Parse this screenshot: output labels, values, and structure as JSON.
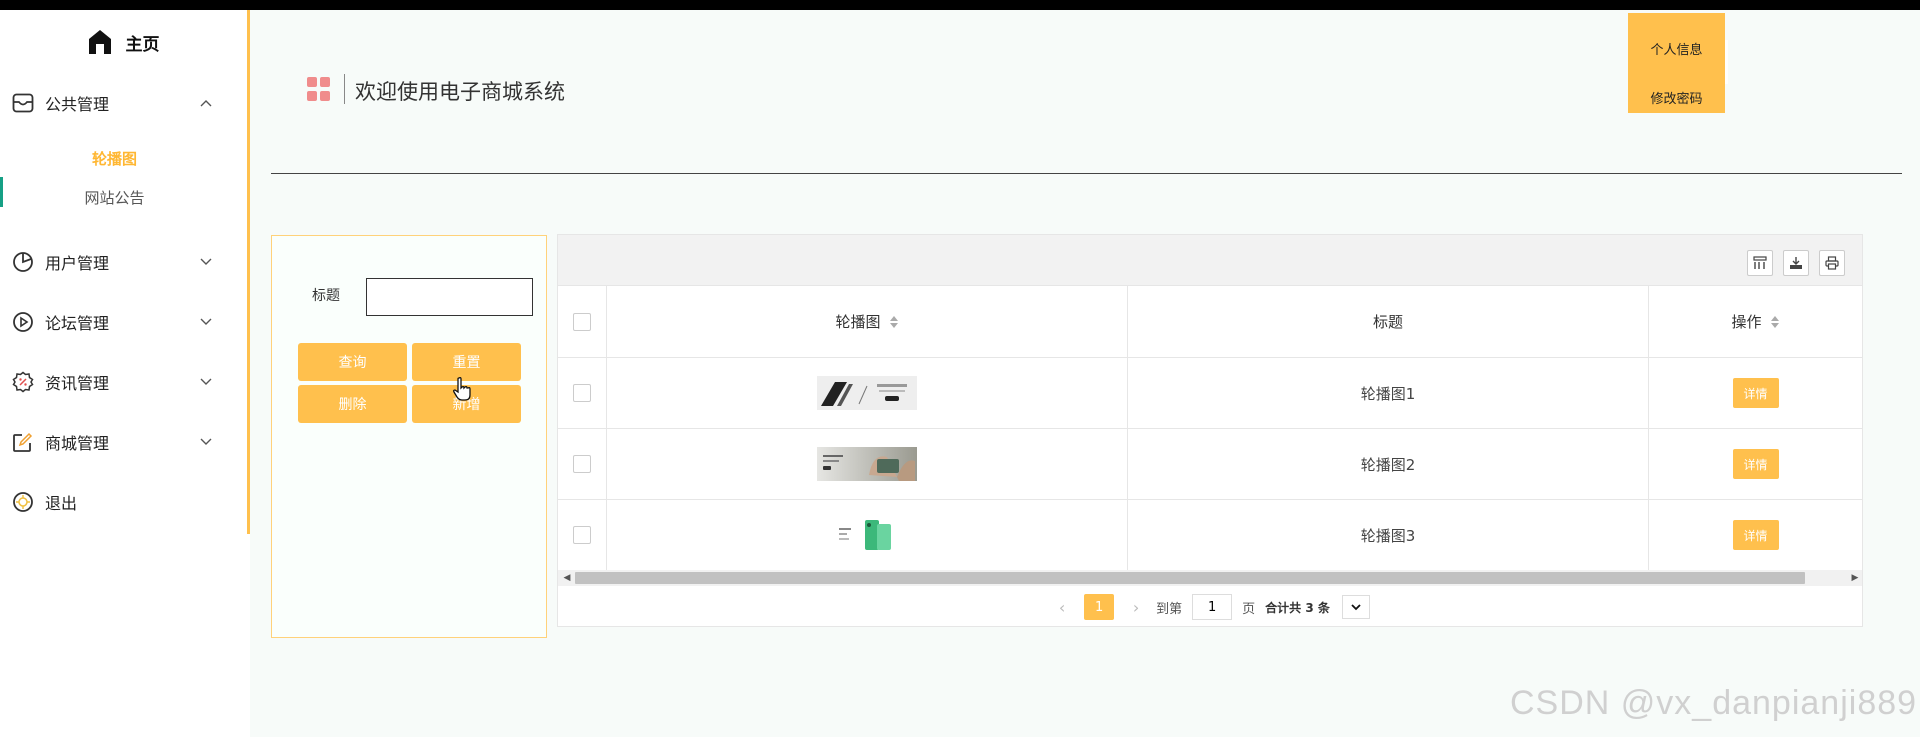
{
  "sidebar": {
    "home_label": "主页",
    "menus": [
      {
        "label": "公共管理",
        "icon": "inbox-icon",
        "expanded": true
      },
      {
        "label": "用户管理",
        "icon": "pie-chart-icon",
        "expanded": false
      },
      {
        "label": "论坛管理",
        "icon": "play-circle-icon",
        "expanded": false
      },
      {
        "label": "资讯管理",
        "icon": "badge-percent-icon",
        "expanded": false
      },
      {
        "label": "商城管理",
        "icon": "edit-note-icon",
        "expanded": false
      },
      {
        "label": "退出",
        "icon": "exit-icon"
      }
    ],
    "sub_items": [
      {
        "label": "轮播图",
        "active": true
      },
      {
        "label": "网站公告",
        "active": false
      }
    ]
  },
  "header": {
    "title": "欢迎使用电子商城系统",
    "user_menu": [
      "个人信息",
      "修改密码"
    ]
  },
  "search": {
    "title_label": "标题",
    "title_value": "",
    "buttons": [
      "查询",
      "重置",
      "删除",
      "新增"
    ]
  },
  "table": {
    "columns": [
      "轮播图",
      "标题",
      "操作"
    ],
    "rows": [
      {
        "title": "轮播图1",
        "action": "详情"
      },
      {
        "title": "轮播图2",
        "action": "详情"
      },
      {
        "title": "轮播图3",
        "action": "详情"
      }
    ]
  },
  "pagination": {
    "current": "1",
    "goto_label": "到第",
    "goto_value": "1",
    "page_unit": "页",
    "total_text": "合计共 3 条"
  },
  "watermark": "CSDN @vx_danpianji889",
  "colors": {
    "accent": "#ffc04d",
    "active_text": "#ffb733",
    "header_icon": "#f08c8c"
  }
}
